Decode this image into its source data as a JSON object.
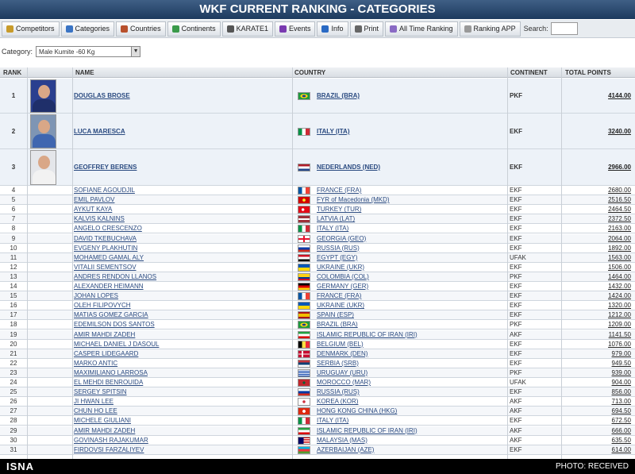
{
  "header": {
    "title": "WKF CURRENT RANKING - CATEGORIES"
  },
  "toolbar": {
    "buttons": [
      {
        "label": "Competitors",
        "icon": "users-icon",
        "color": "#c89b2a"
      },
      {
        "label": "Categories",
        "icon": "categories-icon",
        "color": "#3a74c4"
      },
      {
        "label": "Countries",
        "icon": "globe-icon",
        "color": "#b8502c"
      },
      {
        "label": "Continents",
        "icon": "continents-icon",
        "color": "#3a9a4a"
      },
      {
        "label": "KARATE1",
        "icon": "karate-icon",
        "color": "#555555"
      },
      {
        "label": "Events",
        "icon": "events-icon",
        "color": "#7a3ab0"
      },
      {
        "label": "Info",
        "icon": "info-icon",
        "color": "#2a6ac4"
      },
      {
        "label": "Print",
        "icon": "print-icon",
        "color": "#666666"
      },
      {
        "label": "All Time Ranking",
        "icon": "ranking-icon",
        "color": "#8a6ac4"
      },
      {
        "label": "Ranking APP",
        "icon": "app-icon",
        "color": "#999999"
      }
    ],
    "search_label": "Search:"
  },
  "category": {
    "label": "Category:",
    "selected": "Male Kumite -60 Kg"
  },
  "table": {
    "headers": {
      "rank": "RANK",
      "name": "NAME",
      "country": "COUNTRY",
      "continent": "CONTINENT",
      "points": "TOTAL POINTS"
    },
    "top_rows": [
      {
        "rank": "1",
        "name": "DOUGLAS BROSE",
        "country": "BRAZIL (BRA)",
        "continent": "PKF",
        "points": "4144.00",
        "flag": "brazil"
      },
      {
        "rank": "2",
        "name": "LUCA MARESCA",
        "country": "ITALY (ITA)",
        "continent": "EKF",
        "points": "3240.00",
        "flag": "italy"
      },
      {
        "rank": "3",
        "name": "GEOFFREY BERENS",
        "country": "NEDERLANDS (NED)",
        "continent": "EKF",
        "points": "2966.00",
        "flag": "netherlands"
      }
    ],
    "rows": [
      {
        "rank": "4",
        "name": "SOFIANE AGOUDJIL",
        "country": "FRANCE (FRA)",
        "continent": "EKF",
        "points": "2680.00",
        "flag": "france"
      },
      {
        "rank": "5",
        "name": "EMIL PAVLOV",
        "country": "FYR of Macedonia (MKD)",
        "continent": "EKF",
        "points": "2516.50",
        "flag": "macedonia"
      },
      {
        "rank": "6",
        "name": "AYKUT KAYA",
        "country": "TURKEY (TUR)",
        "continent": "EKF",
        "points": "2464.50",
        "flag": "turkey"
      },
      {
        "rank": "7",
        "name": "KALVIS KALNINS",
        "country": "LATVIA (LAT)",
        "continent": "EKF",
        "points": "2372.50",
        "flag": "latvia"
      },
      {
        "rank": "8",
        "name": "ANGELO CRESCENZO",
        "country": "ITALY (ITA)",
        "continent": "EKF",
        "points": "2163.00",
        "flag": "italy"
      },
      {
        "rank": "9",
        "name": "DAVID TKEBUCHAVA",
        "country": "GEORGIA (GEO)",
        "continent": "EKF",
        "points": "2064.00",
        "flag": "georgia"
      },
      {
        "rank": "10",
        "name": "EVGENY PLAKHUTIN",
        "country": "RUSSIA (RUS)",
        "continent": "EKF",
        "points": "1892.00",
        "flag": "russia"
      },
      {
        "rank": "11",
        "name": "MOHAMED GAMAL ALY",
        "country": "EGYPT (EGY)",
        "continent": "UFAK",
        "points": "1563.00",
        "flag": "egypt"
      },
      {
        "rank": "12",
        "name": "VITALII SEMENTSOV",
        "country": "UKRAINE (UKR)",
        "continent": "EKF",
        "points": "1506.00",
        "flag": "ukraine"
      },
      {
        "rank": "13",
        "name": "ANDRES RENDON LLANOS",
        "country": "COLOMBIA (COL)",
        "continent": "PKF",
        "points": "1464.00",
        "flag": "colombia"
      },
      {
        "rank": "14",
        "name": "ALEXANDER HEIMANN",
        "country": "GERMANY (GER)",
        "continent": "EKF",
        "points": "1432.00",
        "flag": "germany"
      },
      {
        "rank": "15",
        "name": "JOHAN LOPES",
        "country": "FRANCE (FRA)",
        "continent": "EKF",
        "points": "1424.00",
        "flag": "france"
      },
      {
        "rank": "16",
        "name": "OLEH FILIPOVYCH",
        "country": "UKRAINE (UKR)",
        "continent": "EKF",
        "points": "1320.00",
        "flag": "ukraine"
      },
      {
        "rank": "17",
        "name": "MATIAS GOMEZ GARCIA",
        "country": "SPAIN (ESP)",
        "continent": "EKF",
        "points": "1212.00",
        "flag": "spain"
      },
      {
        "rank": "18",
        "name": "EDEMILSON DOS SANTOS",
        "country": "BRAZIL (BRA)",
        "continent": "PKF",
        "points": "1209.00",
        "flag": "brazil"
      },
      {
        "rank": "19",
        "name": "AMIR MAHDI ZADEH",
        "country": "ISLAMIC REPUBLIC OF IRAN (IRI)",
        "continent": "AKF",
        "points": "1141.50",
        "flag": "iran"
      },
      {
        "rank": "20",
        "name": "MICHAEL DANIEL J DASOUL",
        "country": "BELGIUM (BEL)",
        "continent": "EKF",
        "points": "1076.00",
        "flag": "belgium"
      },
      {
        "rank": "21",
        "name": "CASPER LIDEGAARD",
        "country": "DENMARK (DEN)",
        "continent": "EKF",
        "points": "979.00",
        "flag": "denmark"
      },
      {
        "rank": "22",
        "name": "MARKO ANTIC",
        "country": "SERBIA (SRB)",
        "continent": "EKF",
        "points": "949.50",
        "flag": "serbia"
      },
      {
        "rank": "23",
        "name": "MAXIMILIANO LARROSA",
        "country": "URUGUAY (URU)",
        "continent": "PKF",
        "points": "939.00",
        "flag": "uruguay"
      },
      {
        "rank": "24",
        "name": "EL MEHDI BENROUIDA",
        "country": "MOROCCO (MAR)",
        "continent": "UFAK",
        "points": "904.00",
        "flag": "morocco"
      },
      {
        "rank": "25",
        "name": "SERGEY SPITSIN",
        "country": "RUSSIA (RUS)",
        "continent": "EKF",
        "points": "856.00",
        "flag": "russia"
      },
      {
        "rank": "26",
        "name": "JI HWAN LEE",
        "country": "KOREA (KOR)",
        "continent": "AKF",
        "points": "713.00",
        "flag": "korea"
      },
      {
        "rank": "27",
        "name": "CHUN HO LEE",
        "country": "HONG KONG CHINA (HKG)",
        "continent": "AKF",
        "points": "694.50",
        "flag": "hongkong"
      },
      {
        "rank": "28",
        "name": "MICHELE GIULIANI",
        "country": "ITALY (ITA)",
        "continent": "EKF",
        "points": "672.50",
        "flag": "italy"
      },
      {
        "rank": "29",
        "name": "AMIR MAHDI ZADEH",
        "country": "ISLAMIC REPUBLIC OF IRAN (IRI)",
        "continent": "AKF",
        "points": "666.00",
        "flag": "iran"
      },
      {
        "rank": "30",
        "name": "GOVINASH RAJAKUMAR",
        "country": "MALAYSIA (MAS)",
        "continent": "AKF",
        "points": "635.50",
        "flag": "malaysia"
      },
      {
        "rank": "31",
        "name": "FIRDOVSI FARZALIYEV",
        "country": "AZERBAIJAN (AZE)",
        "continent": "EKF",
        "points": "614.00",
        "flag": "azerbaijan"
      }
    ]
  },
  "flag_styles": {
    "brazil": "radial-gradient(ellipse at center, #1a3d8f 22%, #f7d117 24%, #f7d117 45%, #1e9a3e 47%)",
    "italy": "linear-gradient(90deg, #009246 33%, #ffffff 33%, #ffffff 66%, #ce2b37 66%)",
    "netherlands": "linear-gradient(#ae1c28 33%, #ffffff 33%, #ffffff 66%, #21468b 66%)",
    "france": "linear-gradient(90deg, #0055a4 33%, #ffffff 33%, #ffffff 66%, #ef4135 66%)",
    "macedonia": "radial-gradient(circle at center, #f8e92e 22%, #d20000 24%)",
    "turkey": "radial-gradient(circle at 40% 50%, #ffffff 18%, #e30a17 20%)",
    "latvia": "linear-gradient(#9e3039 40%, #ffffff 40%, #ffffff 60%, #9e3039 60%)",
    "georgia": "linear-gradient(90deg, transparent 42%, #e8112d 42%, #e8112d 58%, transparent 58%), linear-gradient(#ffffff 40%, #e8112d 40%, #e8112d 60%, #ffffff 60%)",
    "russia": "linear-gradient(#ffffff 33%, #0039a6 33%, #0039a6 66%, #d52b1e 66%)",
    "egypt": "linear-gradient(#ce1126 33%, #ffffff 33%, #ffffff 66%, #000000 66%)",
    "ukraine": "linear-gradient(#0057b7 50%, #ffd700 50%)",
    "colombia": "linear-gradient(#fcd116 50%, #003893 50%, #003893 75%, #ce1126 75%)",
    "germany": "linear-gradient(#000000 33%, #dd0000 33%, #dd0000 66%, #ffce00 66%)",
    "spain": "linear-gradient(#aa151b 25%, #f1bf00 25%, #f1bf00 75%, #aa151b 75%)",
    "iran": "linear-gradient(#239f40 33%, #ffffff 33%, #ffffff 66%, #da0000 66%)",
    "belgium": "linear-gradient(90deg, #000000 33%, #fae042 33%, #fae042 66%, #ed2939 66%)",
    "denmark": "linear-gradient(90deg, transparent 30%, #ffffff 30%, #ffffff 42%, transparent 42%), linear-gradient(#c60c30 42%, #ffffff 42%, #ffffff 58%, #c60c30 58%)",
    "serbia": "linear-gradient(#c6363c 33%, #0c4076 33%, #0c4076 66%, #ffffff 66%)",
    "uruguay": "repeating-linear-gradient(#ffffff 0, #ffffff 1px, #0038a8 1px, #0038a8 2px)",
    "morocco": "radial-gradient(circle at center, #006233 18%, #c1272d 22%)",
    "korea": "radial-gradient(circle at center, #cd2e3a 20%, #ffffff 24%)",
    "hongkong": "radial-gradient(circle at center, #ffffff 22%, #de2910 26%)",
    "malaysia": "linear-gradient(90deg, #010066 45%, transparent 45%), repeating-linear-gradient(#cc0001 0, #cc0001 1px, #ffffff 1px, #ffffff 2px)",
    "azerbaijan": "linear-gradient(#00b5e2 33%, #ef3340 33%, #ef3340 66%, #509e2f 66%)"
  },
  "footer": {
    "logo": "ISNA",
    "credit": "PHOTO: RECEIVED"
  }
}
